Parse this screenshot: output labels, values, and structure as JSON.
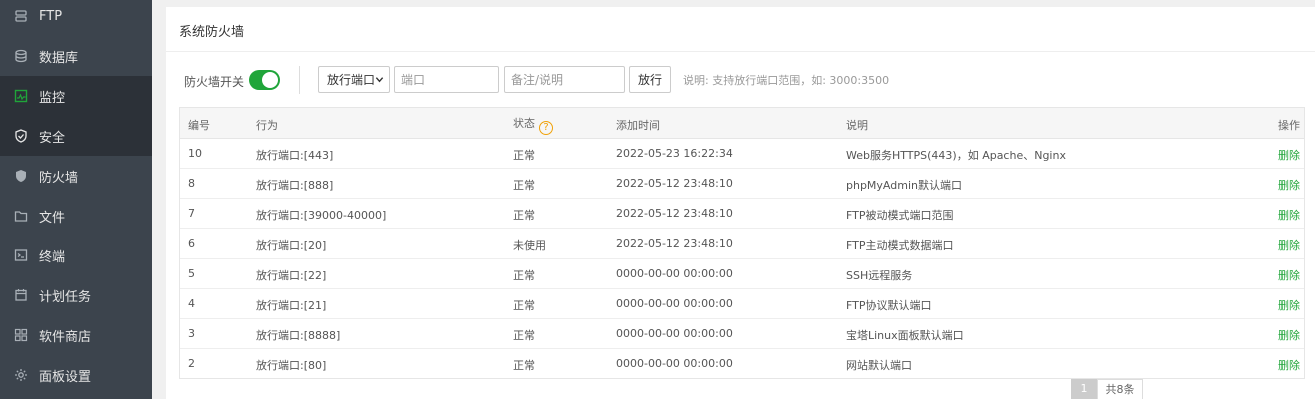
{
  "sidebar": {
    "items": [
      {
        "label": "FTP",
        "icon": "server-icon"
      },
      {
        "label": "数据库",
        "icon": "database-icon"
      },
      {
        "label": "监控",
        "icon": "monitor-icon"
      },
      {
        "label": "安全",
        "icon": "shield-check-icon"
      },
      {
        "label": "防火墙",
        "icon": "shield-icon"
      },
      {
        "label": "文件",
        "icon": "folder-icon"
      },
      {
        "label": "终端",
        "icon": "terminal-icon"
      },
      {
        "label": "计划任务",
        "icon": "calendar-icon"
      },
      {
        "label": "软件商店",
        "icon": "grid-icon"
      },
      {
        "label": "面板设置",
        "icon": "gear-icon"
      }
    ]
  },
  "panel": {
    "title": "系统防火墙"
  },
  "toolbar": {
    "switch_label": "防火墙开关",
    "switch_on": true,
    "select_value": "放行端口",
    "port_placeholder": "端口",
    "note_placeholder": "备注/说明",
    "submit_label": "放行",
    "hint": "说明: 支持放行端口范围，如: 3000:3500"
  },
  "table": {
    "headers": {
      "id": "编号",
      "action": "行为",
      "status": "状态",
      "status_help": "?",
      "time": "添加时间",
      "desc": "说明",
      "op": "操作"
    },
    "rows": [
      {
        "id": "10",
        "action": "放行端口:[443]",
        "status": "正常",
        "time": "2022-05-23 16:22:34",
        "desc": "Web服务HTTPS(443)，如 Apache、Nginx",
        "op": "删除"
      },
      {
        "id": "8",
        "action": "放行端口:[888]",
        "status": "正常",
        "time": "2022-05-12 23:48:10",
        "desc": "phpMyAdmin默认端口",
        "op": "删除"
      },
      {
        "id": "7",
        "action": "放行端口:[39000-40000]",
        "status": "正常",
        "time": "2022-05-12 23:48:10",
        "desc": "FTP被动模式端口范围",
        "op": "删除"
      },
      {
        "id": "6",
        "action": "放行端口:[20]",
        "status": "未使用",
        "time": "2022-05-12 23:48:10",
        "desc": "FTP主动模式数据端口",
        "op": "删除"
      },
      {
        "id": "5",
        "action": "放行端口:[22]",
        "status": "正常",
        "time": "0000-00-00 00:00:00",
        "desc": "SSH远程服务",
        "op": "删除"
      },
      {
        "id": "4",
        "action": "放行端口:[21]",
        "status": "正常",
        "time": "0000-00-00 00:00:00",
        "desc": "FTP协议默认端口",
        "op": "删除"
      },
      {
        "id": "3",
        "action": "放行端口:[8888]",
        "status": "正常",
        "time": "0000-00-00 00:00:00",
        "desc": "宝塔Linux面板默认端口",
        "op": "删除"
      },
      {
        "id": "2",
        "action": "放行端口:[80]",
        "status": "正常",
        "time": "0000-00-00 00:00:00",
        "desc": "网站默认端口",
        "op": "删除"
      }
    ]
  },
  "pagination": {
    "current": "1",
    "total": "共8条"
  },
  "colors": {
    "accent": "#20a53a",
    "sidebar_bg": "#3c444d",
    "sidebar_active_bg": "#2c3138",
    "help_icon": "#f0a20a"
  }
}
